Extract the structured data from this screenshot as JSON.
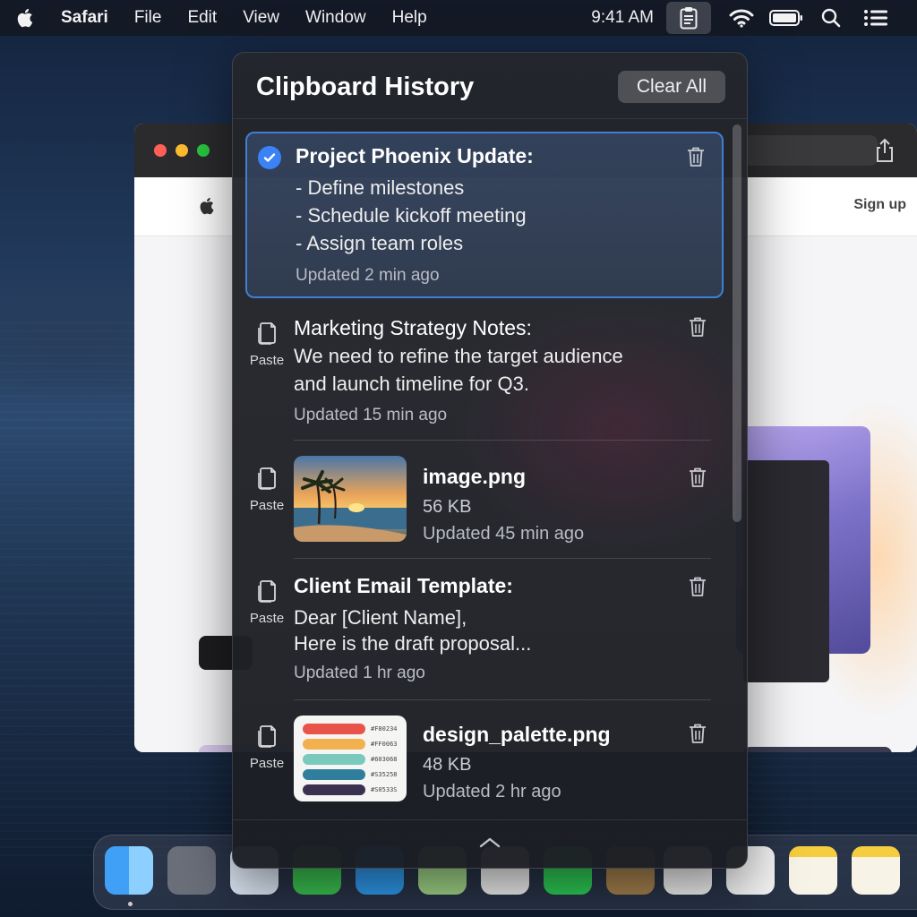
{
  "menubar": {
    "app_name": "Safari",
    "menus": [
      "File",
      "Edit",
      "View",
      "Window",
      "Help"
    ],
    "clock": "9:41 AM"
  },
  "background_window": {
    "signup": "Sign up"
  },
  "panel": {
    "title": "Clipboard History",
    "clear_all": "Clear All",
    "paste_label": "Paste",
    "items": [
      {
        "title": "Project Phoenix Update:",
        "lines": [
          "- Define milestones",
          "- Schedule kickoff meeting",
          "- Assign team roles"
        ],
        "meta": "Updated 2 min ago",
        "selected": true
      },
      {
        "title": "Marketing Strategy Notes:",
        "lines": [
          "We need to refine the target audience",
          "and launch timeline for Q3."
        ],
        "meta": "Updated 15 min ago"
      },
      {
        "title": "image.png",
        "size": "56 KB",
        "meta": "Updated 45 min ago",
        "thumbnail": "beach-sunset"
      },
      {
        "title": "Client Email Template:",
        "lines": [
          "Dear [Client Name],",
          "Here is the draft proposal..."
        ],
        "meta": "Updated 1 hr ago"
      },
      {
        "title": "design_palette.png",
        "size": "48 KB",
        "meta": "Updated 2 hr ago",
        "thumbnail": "color-palette",
        "palette": [
          {
            "color": "#e8534a",
            "hex": "#F80234"
          },
          {
            "color": "#f3b04f",
            "hex": "#FF0063"
          },
          {
            "color": "#79c9bd",
            "hex": "#603068"
          },
          {
            "color": "#2f7f9c",
            "hex": "#S35258"
          },
          {
            "color": "#3a3150",
            "hex": "#S0533S"
          }
        ]
      }
    ]
  },
  "icons": {
    "apple": "apple-logo-icon",
    "clipboard": "clipboard-icon",
    "wifi": "wifi-icon",
    "battery": "battery-icon",
    "search": "search-icon",
    "control_center": "control-center-icon",
    "check": "checkmark-icon",
    "paste": "paste-document-icon",
    "trash": "trash-icon",
    "chevron": "chevron-up-icon"
  },
  "colors": {
    "accent": "#3b82f6",
    "panel_bg": "#24262c"
  }
}
